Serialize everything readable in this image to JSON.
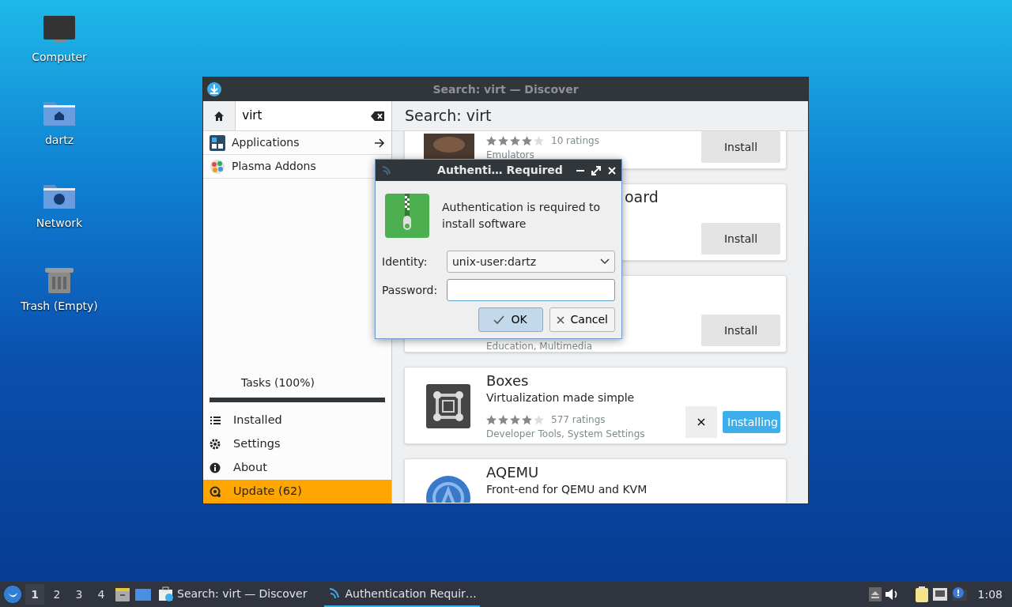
{
  "desktop_icons": [
    {
      "label": "Computer",
      "kind": "computer"
    },
    {
      "label": "dartz",
      "kind": "home"
    },
    {
      "label": "Network",
      "kind": "network"
    },
    {
      "label": "Trash (Empty)",
      "kind": "trash"
    }
  ],
  "discover": {
    "title": "Search: virt — Discover",
    "search": {
      "value": "virt"
    },
    "categories": [
      {
        "label": "Applications",
        "kind": "applications"
      },
      {
        "label": "Plasma Addons",
        "kind": "addons"
      }
    ],
    "tasks": {
      "label": "Tasks (100%)",
      "level": 1
    },
    "nav": [
      {
        "label": "Installed",
        "kind": "list",
        "selected": false
      },
      {
        "label": "Settings",
        "kind": "settings",
        "selected": false
      },
      {
        "label": "About",
        "kind": "about",
        "selected": false
      },
      {
        "label": "Update (62)",
        "kind": "update",
        "selected": true
      }
    ],
    "heading": "Search: virt",
    "results": [
      {
        "kind": "photo",
        "stars": 4,
        "ratings": "10 ratings",
        "categories": "Emulators",
        "action": "Install",
        "installing": false
      },
      {
        "name": "oard",
        "action": "Install",
        "installing": false
      },
      {
        "categories": "Education, Multimedia",
        "action": "Install",
        "installing": false
      },
      {
        "kind": "boxes",
        "name": "Boxes",
        "summary": "Virtualization made simple",
        "stars": 4,
        "ratings": "577 ratings",
        "categories": "Developer Tools, System Settings",
        "action": "Installing",
        "installing": true,
        "cancel": "×"
      },
      {
        "kind": "aqemu",
        "name": "AQEMU",
        "summary": "Front-end for QEMU and KVM"
      }
    ]
  },
  "dialog": {
    "title": "Authenti… Required",
    "message": "Authentication is required to install software",
    "identity_label": "Identity:",
    "identity": "unix-user:dartz",
    "password_label": "Password:",
    "ok": "OK",
    "cancel": "Cancel"
  },
  "taskbar": {
    "workspaces": [
      {
        "label": "1",
        "selected": true
      },
      {
        "label": "2",
        "selected": false
      },
      {
        "label": "3",
        "selected": false
      },
      {
        "label": "4",
        "selected": false
      }
    ],
    "tasks": [
      {
        "label": "Search: virt — Discover",
        "selected": false
      },
      {
        "label": "Authentication Requir…",
        "selected": true
      }
    ],
    "clock": "1:08"
  }
}
